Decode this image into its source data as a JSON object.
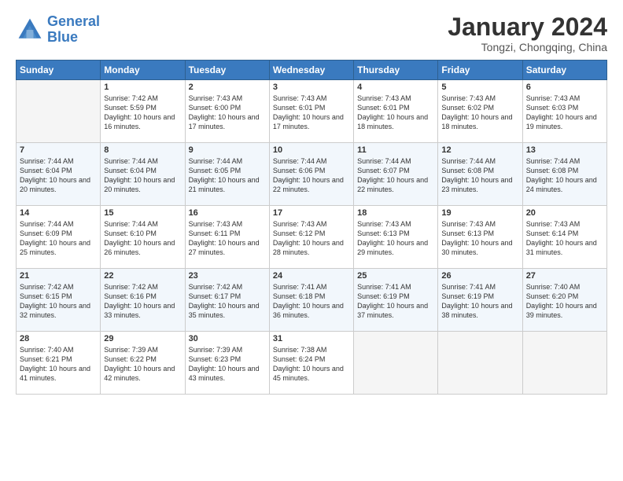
{
  "logo": {
    "line1": "General",
    "line2": "Blue"
  },
  "title": "January 2024",
  "subtitle": "Tongzi, Chongqing, China",
  "headers": [
    "Sunday",
    "Monday",
    "Tuesday",
    "Wednesday",
    "Thursday",
    "Friday",
    "Saturday"
  ],
  "weeks": [
    [
      {
        "num": "",
        "sunrise": "",
        "sunset": "",
        "daylight": "",
        "empty": true
      },
      {
        "num": "1",
        "sunrise": "Sunrise: 7:42 AM",
        "sunset": "Sunset: 5:59 PM",
        "daylight": "Daylight: 10 hours and 16 minutes."
      },
      {
        "num": "2",
        "sunrise": "Sunrise: 7:43 AM",
        "sunset": "Sunset: 6:00 PM",
        "daylight": "Daylight: 10 hours and 17 minutes."
      },
      {
        "num": "3",
        "sunrise": "Sunrise: 7:43 AM",
        "sunset": "Sunset: 6:01 PM",
        "daylight": "Daylight: 10 hours and 17 minutes."
      },
      {
        "num": "4",
        "sunrise": "Sunrise: 7:43 AM",
        "sunset": "Sunset: 6:01 PM",
        "daylight": "Daylight: 10 hours and 18 minutes."
      },
      {
        "num": "5",
        "sunrise": "Sunrise: 7:43 AM",
        "sunset": "Sunset: 6:02 PM",
        "daylight": "Daylight: 10 hours and 18 minutes."
      },
      {
        "num": "6",
        "sunrise": "Sunrise: 7:43 AM",
        "sunset": "Sunset: 6:03 PM",
        "daylight": "Daylight: 10 hours and 19 minutes."
      }
    ],
    [
      {
        "num": "7",
        "sunrise": "Sunrise: 7:44 AM",
        "sunset": "Sunset: 6:04 PM",
        "daylight": "Daylight: 10 hours and 20 minutes."
      },
      {
        "num": "8",
        "sunrise": "Sunrise: 7:44 AM",
        "sunset": "Sunset: 6:04 PM",
        "daylight": "Daylight: 10 hours and 20 minutes."
      },
      {
        "num": "9",
        "sunrise": "Sunrise: 7:44 AM",
        "sunset": "Sunset: 6:05 PM",
        "daylight": "Daylight: 10 hours and 21 minutes."
      },
      {
        "num": "10",
        "sunrise": "Sunrise: 7:44 AM",
        "sunset": "Sunset: 6:06 PM",
        "daylight": "Daylight: 10 hours and 22 minutes."
      },
      {
        "num": "11",
        "sunrise": "Sunrise: 7:44 AM",
        "sunset": "Sunset: 6:07 PM",
        "daylight": "Daylight: 10 hours and 22 minutes."
      },
      {
        "num": "12",
        "sunrise": "Sunrise: 7:44 AM",
        "sunset": "Sunset: 6:08 PM",
        "daylight": "Daylight: 10 hours and 23 minutes."
      },
      {
        "num": "13",
        "sunrise": "Sunrise: 7:44 AM",
        "sunset": "Sunset: 6:08 PM",
        "daylight": "Daylight: 10 hours and 24 minutes."
      }
    ],
    [
      {
        "num": "14",
        "sunrise": "Sunrise: 7:44 AM",
        "sunset": "Sunset: 6:09 PM",
        "daylight": "Daylight: 10 hours and 25 minutes."
      },
      {
        "num": "15",
        "sunrise": "Sunrise: 7:44 AM",
        "sunset": "Sunset: 6:10 PM",
        "daylight": "Daylight: 10 hours and 26 minutes."
      },
      {
        "num": "16",
        "sunrise": "Sunrise: 7:43 AM",
        "sunset": "Sunset: 6:11 PM",
        "daylight": "Daylight: 10 hours and 27 minutes."
      },
      {
        "num": "17",
        "sunrise": "Sunrise: 7:43 AM",
        "sunset": "Sunset: 6:12 PM",
        "daylight": "Daylight: 10 hours and 28 minutes."
      },
      {
        "num": "18",
        "sunrise": "Sunrise: 7:43 AM",
        "sunset": "Sunset: 6:13 PM",
        "daylight": "Daylight: 10 hours and 29 minutes."
      },
      {
        "num": "19",
        "sunrise": "Sunrise: 7:43 AM",
        "sunset": "Sunset: 6:13 PM",
        "daylight": "Daylight: 10 hours and 30 minutes."
      },
      {
        "num": "20",
        "sunrise": "Sunrise: 7:43 AM",
        "sunset": "Sunset: 6:14 PM",
        "daylight": "Daylight: 10 hours and 31 minutes."
      }
    ],
    [
      {
        "num": "21",
        "sunrise": "Sunrise: 7:42 AM",
        "sunset": "Sunset: 6:15 PM",
        "daylight": "Daylight: 10 hours and 32 minutes."
      },
      {
        "num": "22",
        "sunrise": "Sunrise: 7:42 AM",
        "sunset": "Sunset: 6:16 PM",
        "daylight": "Daylight: 10 hours and 33 minutes."
      },
      {
        "num": "23",
        "sunrise": "Sunrise: 7:42 AM",
        "sunset": "Sunset: 6:17 PM",
        "daylight": "Daylight: 10 hours and 35 minutes."
      },
      {
        "num": "24",
        "sunrise": "Sunrise: 7:41 AM",
        "sunset": "Sunset: 6:18 PM",
        "daylight": "Daylight: 10 hours and 36 minutes."
      },
      {
        "num": "25",
        "sunrise": "Sunrise: 7:41 AM",
        "sunset": "Sunset: 6:19 PM",
        "daylight": "Daylight: 10 hours and 37 minutes."
      },
      {
        "num": "26",
        "sunrise": "Sunrise: 7:41 AM",
        "sunset": "Sunset: 6:19 PM",
        "daylight": "Daylight: 10 hours and 38 minutes."
      },
      {
        "num": "27",
        "sunrise": "Sunrise: 7:40 AM",
        "sunset": "Sunset: 6:20 PM",
        "daylight": "Daylight: 10 hours and 39 minutes."
      }
    ],
    [
      {
        "num": "28",
        "sunrise": "Sunrise: 7:40 AM",
        "sunset": "Sunset: 6:21 PM",
        "daylight": "Daylight: 10 hours and 41 minutes."
      },
      {
        "num": "29",
        "sunrise": "Sunrise: 7:39 AM",
        "sunset": "Sunset: 6:22 PM",
        "daylight": "Daylight: 10 hours and 42 minutes."
      },
      {
        "num": "30",
        "sunrise": "Sunrise: 7:39 AM",
        "sunset": "Sunset: 6:23 PM",
        "daylight": "Daylight: 10 hours and 43 minutes."
      },
      {
        "num": "31",
        "sunrise": "Sunrise: 7:38 AM",
        "sunset": "Sunset: 6:24 PM",
        "daylight": "Daylight: 10 hours and 45 minutes."
      },
      {
        "num": "",
        "sunrise": "",
        "sunset": "",
        "daylight": "",
        "empty": true
      },
      {
        "num": "",
        "sunrise": "",
        "sunset": "",
        "daylight": "",
        "empty": true
      },
      {
        "num": "",
        "sunrise": "",
        "sunset": "",
        "daylight": "",
        "empty": true
      }
    ]
  ]
}
